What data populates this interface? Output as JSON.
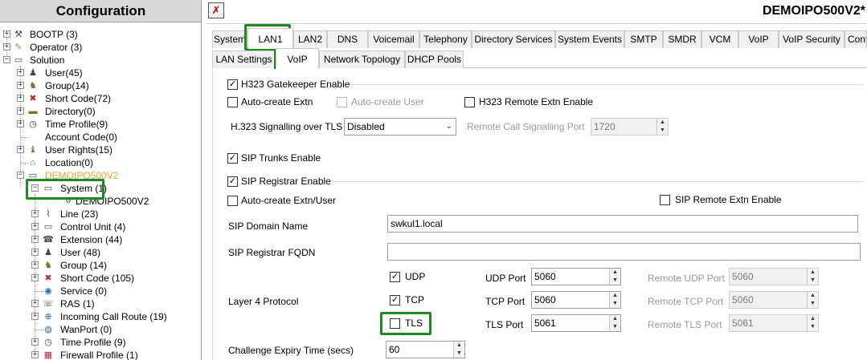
{
  "tree": {
    "title": "Configuration",
    "items": [
      {
        "label": "BOOTP (3)",
        "icon": "bootp-icon"
      },
      {
        "label": "Operator (3)",
        "icon": "operator-icon"
      },
      {
        "label": "Solution",
        "icon": "solution-icon"
      },
      {
        "label": "User(45)",
        "icon": "user-icon"
      },
      {
        "label": "Group(14)",
        "icon": "group-icon"
      },
      {
        "label": "Short Code(72)",
        "icon": "short-code-icon"
      },
      {
        "label": "Directory(0)",
        "icon": "directory-icon"
      },
      {
        "label": "Time Profile(9)",
        "icon": "time-profile-icon"
      },
      {
        "label": "Account Code(0)",
        "icon": "account-code-icon"
      },
      {
        "label": "User Rights(15)",
        "icon": "user-rights-icon"
      },
      {
        "label": "Location(0)",
        "icon": "location-icon"
      },
      {
        "label": "DEMOIPO500V2",
        "icon": "system-node-icon"
      },
      {
        "label": "System (1)",
        "icon": "system-icon"
      },
      {
        "label": "DEMOIPO500V2",
        "icon": "system-unit-icon"
      },
      {
        "label": "Line (23)",
        "icon": "line-icon"
      },
      {
        "label": "Control Unit (4)",
        "icon": "control-unit-icon"
      },
      {
        "label": "Extension (44)",
        "icon": "extension-icon"
      },
      {
        "label": "User (48)",
        "icon": "user-icon"
      },
      {
        "label": "Group (14)",
        "icon": "group-icon"
      },
      {
        "label": "Short Code (105)",
        "icon": "short-code-icon"
      },
      {
        "label": "Service (0)",
        "icon": "service-icon"
      },
      {
        "label": "RAS (1)",
        "icon": "ras-icon"
      },
      {
        "label": "Incoming Call Route (19)",
        "icon": "incoming-call-route-icon"
      },
      {
        "label": "WanPort (0)",
        "icon": "wanport-icon"
      },
      {
        "label": "Time Profile (9)",
        "icon": "time-profile-icon"
      },
      {
        "label": "Firewall Profile (1)",
        "icon": "firewall-profile-icon"
      }
    ]
  },
  "header": {
    "system_title": "DEMOIPO500V2*",
    "app_icon": "manager-icon"
  },
  "tabs_main": [
    "System",
    "LAN1",
    "LAN2",
    "DNS",
    "Voicemail",
    "Telephony",
    "Directory Services",
    "System Events",
    "SMTP",
    "SMDR",
    "VCM",
    "VoIP",
    "VoIP Security",
    "Contact"
  ],
  "tabs_sub": [
    "LAN Settings",
    "VoIP",
    "Network Topology",
    "DHCP Pools"
  ],
  "voip": {
    "h323_gatekeeper_enable": "H323 Gatekeeper Enable",
    "auto_create_extn": "Auto-create Extn",
    "auto_create_user": "Auto-create User",
    "h323_remote_extn_enable": "H323 Remote Extn Enable",
    "h323_signalling_label": "H.323 Signalling over TLS",
    "h323_signalling_value": "Disabled",
    "remote_call_signalling_port_label": "Remote Call Signalling Port",
    "remote_call_signalling_port_value": "1720",
    "sip_trunks_enable": "SIP Trunks Enable",
    "sip_registrar_enable": "SIP Registrar Enable",
    "auto_create_extn_user": "Auto-create Extn/User",
    "sip_remote_extn_enable": "SIP Remote Extn Enable",
    "sip_domain_name_label": "SIP Domain Name",
    "sip_domain_name_value": "swkul1.local",
    "sip_registrar_fqdn_label": "SIP Registrar FQDN",
    "sip_registrar_fqdn_value": "",
    "layer4_protocol_label": "Layer 4 Protocol",
    "udp": "UDP",
    "tcp": "TCP",
    "tls": "TLS",
    "udp_port_label": "UDP Port",
    "udp_port_value": "5060",
    "tcp_port_label": "TCP Port",
    "tcp_port_value": "5060",
    "tls_port_label": "TLS Port",
    "tls_port_value": "5061",
    "remote_udp_port_label": "Remote UDP Port",
    "remote_udp_port_value": "5060",
    "remote_tcp_port_label": "Remote TCP Port",
    "remote_tcp_port_value": "5060",
    "remote_tls_port_label": "Remote TLS Port",
    "remote_tls_port_value": "5061",
    "challenge_expiry_label": "Challenge Expiry Time (secs)",
    "challenge_expiry_value": "60"
  },
  "highlight_color": "#1f8a1f",
  "check_mark": "✓"
}
